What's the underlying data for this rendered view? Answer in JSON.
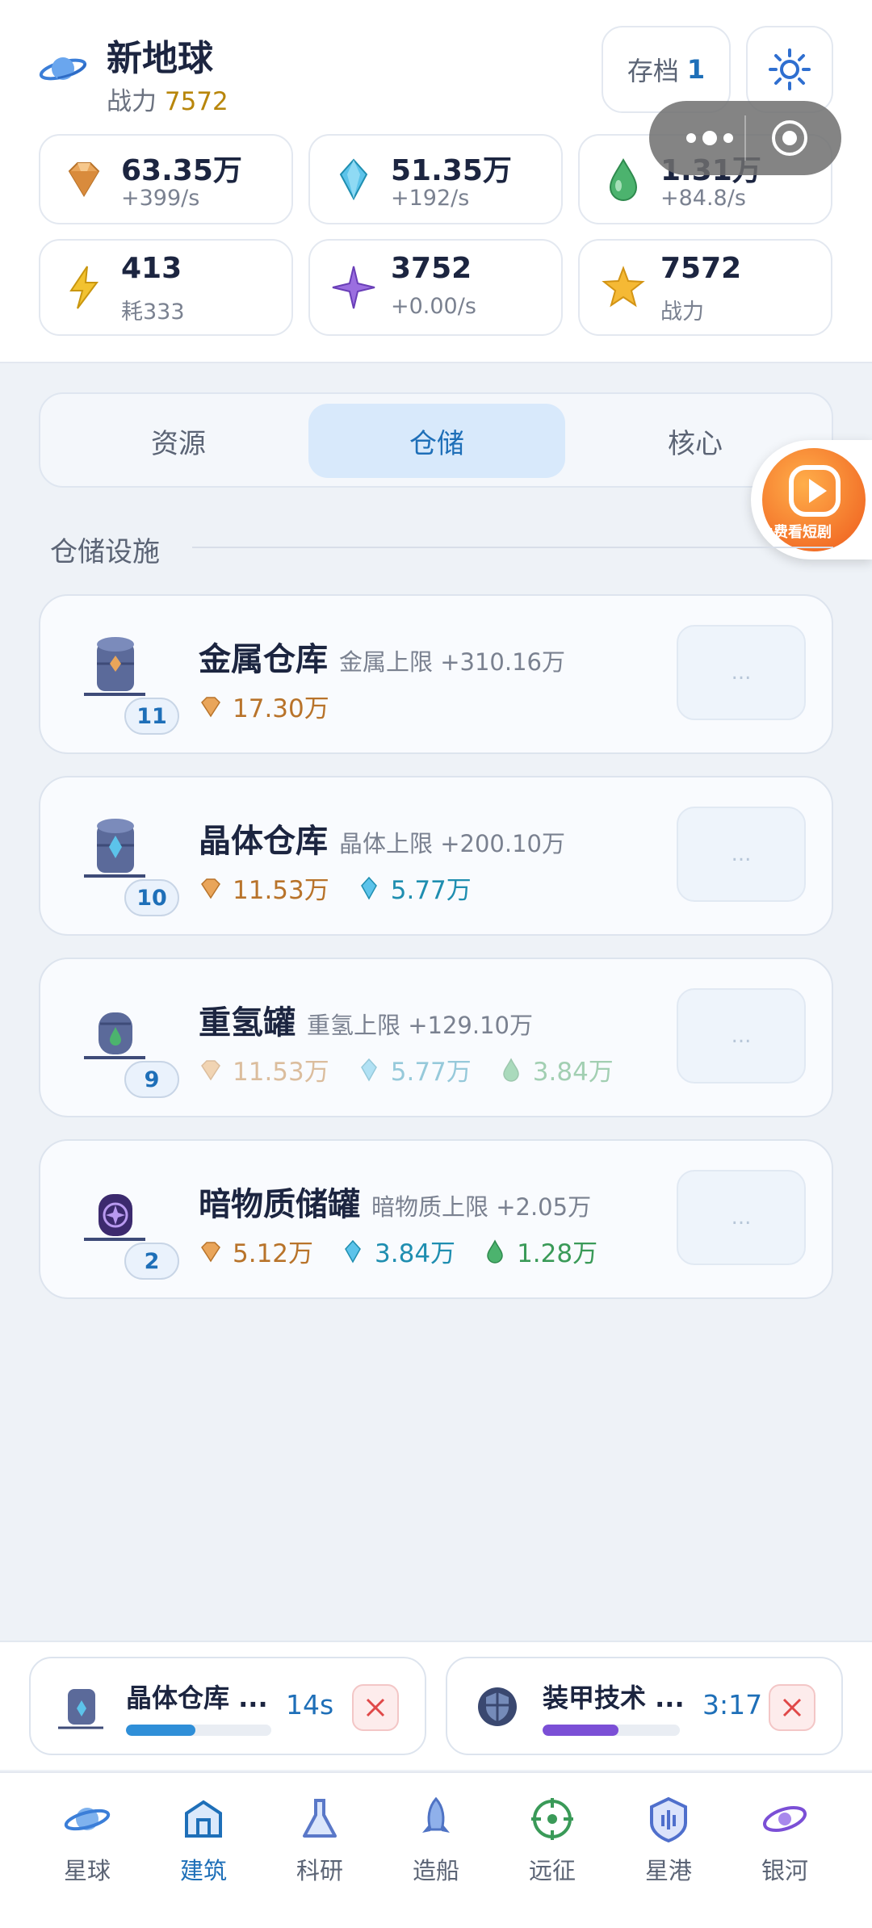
{
  "header": {
    "planet_name": "新地球",
    "power_label": "战力",
    "power_value": "7572",
    "save_label": "存档",
    "save_slot": "1"
  },
  "resources": [
    {
      "icon": "metal-gem-icon",
      "value": "63.35万",
      "rate": "+399/s"
    },
    {
      "icon": "crystal-icon",
      "value": "51.35万",
      "rate": "+192/s"
    },
    {
      "icon": "deuterium-drop-icon",
      "value": "1.31万",
      "rate": "+84.8/s"
    },
    {
      "icon": "energy-bolt-icon",
      "value": "413",
      "rate": "耗333"
    },
    {
      "icon": "dark-matter-star-icon",
      "value": "3752",
      "rate": "+0.00/s"
    },
    {
      "icon": "power-star-icon",
      "value": "7572",
      "rate": "战力"
    }
  ],
  "tabs": [
    {
      "label": "资源",
      "active": false
    },
    {
      "label": "仓储",
      "active": true
    },
    {
      "label": "核心",
      "active": false
    }
  ],
  "float_ad": {
    "text": "免费看短剧"
  },
  "section": {
    "title": "仓储设施"
  },
  "buildings": [
    {
      "name": "金属仓库",
      "effect": "金属上限 +310.16万",
      "level": "11",
      "costs": [
        {
          "type": "metal",
          "value": "17.30万"
        }
      ],
      "dim": false,
      "more": "..."
    },
    {
      "name": "晶体仓库",
      "effect": "晶体上限 +200.10万",
      "level": "10",
      "costs": [
        {
          "type": "metal",
          "value": "11.53万"
        },
        {
          "type": "crystal",
          "value": "5.77万"
        }
      ],
      "dim": false,
      "more": "..."
    },
    {
      "name": "重氢罐",
      "effect": "重氢上限 +129.10万",
      "level": "9",
      "costs": [
        {
          "type": "metal",
          "value": "11.53万"
        },
        {
          "type": "crystal",
          "value": "5.77万"
        },
        {
          "type": "gas",
          "value": "3.84万"
        }
      ],
      "dim": true,
      "more": "..."
    },
    {
      "name": "暗物质储罐",
      "effect": "暗物质上限 +2.05万",
      "level": "2",
      "costs": [
        {
          "type": "metal",
          "value": "5.12万"
        },
        {
          "type": "crystal",
          "value": "3.84万"
        },
        {
          "type": "gas",
          "value": "1.28万"
        }
      ],
      "dim": false,
      "more": "..."
    }
  ],
  "queue": [
    {
      "name": "晶体仓库 ...",
      "time": "14s",
      "progress": 0.48,
      "color": "#2f8fd8"
    },
    {
      "name": "装甲技术 ...",
      "time": "3:17",
      "progress": 0.55,
      "color": "#7b4fd6"
    }
  ],
  "nav": [
    {
      "label": "星球",
      "icon": "planet-icon",
      "active": false
    },
    {
      "label": "建筑",
      "icon": "building-icon",
      "active": true
    },
    {
      "label": "科研",
      "icon": "flask-icon",
      "active": false
    },
    {
      "label": "造船",
      "icon": "rocket-icon",
      "active": false
    },
    {
      "label": "远征",
      "icon": "crosshair-icon",
      "active": false
    },
    {
      "label": "星港",
      "icon": "starport-icon",
      "active": false
    },
    {
      "label": "银河",
      "icon": "galaxy-icon",
      "active": false
    }
  ],
  "colors": {
    "accent": "#1e6fb8",
    "metal": "#b8732a",
    "crystal": "#1f8eb0",
    "gas": "#3a9a58",
    "cancel": "#e04848"
  }
}
